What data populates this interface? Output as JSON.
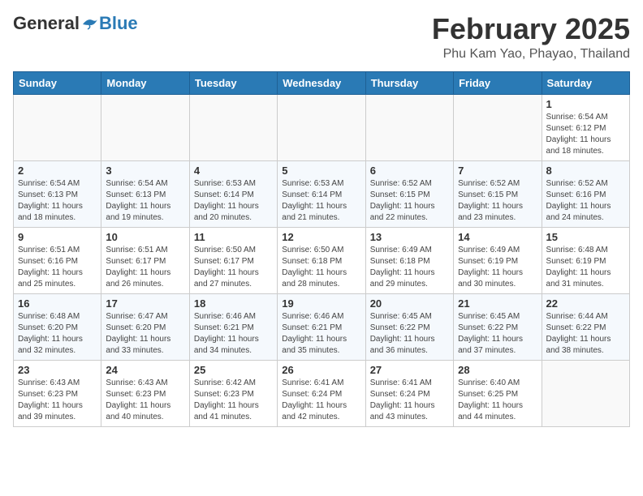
{
  "header": {
    "logo_general": "General",
    "logo_blue": "Blue",
    "month_title": "February 2025",
    "location": "Phu Kam Yao, Phayao, Thailand"
  },
  "weekdays": [
    "Sunday",
    "Monday",
    "Tuesday",
    "Wednesday",
    "Thursday",
    "Friday",
    "Saturday"
  ],
  "weeks": [
    [
      {
        "day": "",
        "info": ""
      },
      {
        "day": "",
        "info": ""
      },
      {
        "day": "",
        "info": ""
      },
      {
        "day": "",
        "info": ""
      },
      {
        "day": "",
        "info": ""
      },
      {
        "day": "",
        "info": ""
      },
      {
        "day": "1",
        "info": "Sunrise: 6:54 AM\nSunset: 6:12 PM\nDaylight: 11 hours\nand 18 minutes."
      }
    ],
    [
      {
        "day": "2",
        "info": "Sunrise: 6:54 AM\nSunset: 6:13 PM\nDaylight: 11 hours\nand 18 minutes."
      },
      {
        "day": "3",
        "info": "Sunrise: 6:54 AM\nSunset: 6:13 PM\nDaylight: 11 hours\nand 19 minutes."
      },
      {
        "day": "4",
        "info": "Sunrise: 6:53 AM\nSunset: 6:14 PM\nDaylight: 11 hours\nand 20 minutes."
      },
      {
        "day": "5",
        "info": "Sunrise: 6:53 AM\nSunset: 6:14 PM\nDaylight: 11 hours\nand 21 minutes."
      },
      {
        "day": "6",
        "info": "Sunrise: 6:52 AM\nSunset: 6:15 PM\nDaylight: 11 hours\nand 22 minutes."
      },
      {
        "day": "7",
        "info": "Sunrise: 6:52 AM\nSunset: 6:15 PM\nDaylight: 11 hours\nand 23 minutes."
      },
      {
        "day": "8",
        "info": "Sunrise: 6:52 AM\nSunset: 6:16 PM\nDaylight: 11 hours\nand 24 minutes."
      }
    ],
    [
      {
        "day": "9",
        "info": "Sunrise: 6:51 AM\nSunset: 6:16 PM\nDaylight: 11 hours\nand 25 minutes."
      },
      {
        "day": "10",
        "info": "Sunrise: 6:51 AM\nSunset: 6:17 PM\nDaylight: 11 hours\nand 26 minutes."
      },
      {
        "day": "11",
        "info": "Sunrise: 6:50 AM\nSunset: 6:17 PM\nDaylight: 11 hours\nand 27 minutes."
      },
      {
        "day": "12",
        "info": "Sunrise: 6:50 AM\nSunset: 6:18 PM\nDaylight: 11 hours\nand 28 minutes."
      },
      {
        "day": "13",
        "info": "Sunrise: 6:49 AM\nSunset: 6:18 PM\nDaylight: 11 hours\nand 29 minutes."
      },
      {
        "day": "14",
        "info": "Sunrise: 6:49 AM\nSunset: 6:19 PM\nDaylight: 11 hours\nand 30 minutes."
      },
      {
        "day": "15",
        "info": "Sunrise: 6:48 AM\nSunset: 6:19 PM\nDaylight: 11 hours\nand 31 minutes."
      }
    ],
    [
      {
        "day": "16",
        "info": "Sunrise: 6:48 AM\nSunset: 6:20 PM\nDaylight: 11 hours\nand 32 minutes."
      },
      {
        "day": "17",
        "info": "Sunrise: 6:47 AM\nSunset: 6:20 PM\nDaylight: 11 hours\nand 33 minutes."
      },
      {
        "day": "18",
        "info": "Sunrise: 6:46 AM\nSunset: 6:21 PM\nDaylight: 11 hours\nand 34 minutes."
      },
      {
        "day": "19",
        "info": "Sunrise: 6:46 AM\nSunset: 6:21 PM\nDaylight: 11 hours\nand 35 minutes."
      },
      {
        "day": "20",
        "info": "Sunrise: 6:45 AM\nSunset: 6:22 PM\nDaylight: 11 hours\nand 36 minutes."
      },
      {
        "day": "21",
        "info": "Sunrise: 6:45 AM\nSunset: 6:22 PM\nDaylight: 11 hours\nand 37 minutes."
      },
      {
        "day": "22",
        "info": "Sunrise: 6:44 AM\nSunset: 6:22 PM\nDaylight: 11 hours\nand 38 minutes."
      }
    ],
    [
      {
        "day": "23",
        "info": "Sunrise: 6:43 AM\nSunset: 6:23 PM\nDaylight: 11 hours\nand 39 minutes."
      },
      {
        "day": "24",
        "info": "Sunrise: 6:43 AM\nSunset: 6:23 PM\nDaylight: 11 hours\nand 40 minutes."
      },
      {
        "day": "25",
        "info": "Sunrise: 6:42 AM\nSunset: 6:23 PM\nDaylight: 11 hours\nand 41 minutes."
      },
      {
        "day": "26",
        "info": "Sunrise: 6:41 AM\nSunset: 6:24 PM\nDaylight: 11 hours\nand 42 minutes."
      },
      {
        "day": "27",
        "info": "Sunrise: 6:41 AM\nSunset: 6:24 PM\nDaylight: 11 hours\nand 43 minutes."
      },
      {
        "day": "28",
        "info": "Sunrise: 6:40 AM\nSunset: 6:25 PM\nDaylight: 11 hours\nand 44 minutes."
      },
      {
        "day": "",
        "info": ""
      }
    ]
  ]
}
